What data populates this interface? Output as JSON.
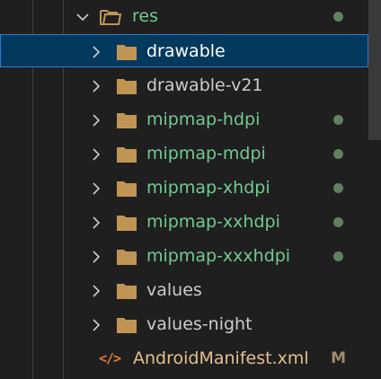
{
  "explorer": {
    "res_folder": {
      "label": "res",
      "expanded": true,
      "status": "modified"
    },
    "items": [
      {
        "label": "drawable",
        "selected": true,
        "status": "none"
      },
      {
        "label": "drawable-v21",
        "selected": false,
        "status": "none"
      },
      {
        "label": "mipmap-hdpi",
        "selected": false,
        "status": "untracked"
      },
      {
        "label": "mipmap-mdpi",
        "selected": false,
        "status": "untracked"
      },
      {
        "label": "mipmap-xhdpi",
        "selected": false,
        "status": "untracked"
      },
      {
        "label": "mipmap-xxhdpi",
        "selected": false,
        "status": "untracked"
      },
      {
        "label": "mipmap-xxxhdpi",
        "selected": false,
        "status": "untracked"
      },
      {
        "label": "values",
        "selected": false,
        "status": "none"
      },
      {
        "label": "values-night",
        "selected": false,
        "status": "none"
      }
    ],
    "manifest": {
      "icon": "xml-file-icon",
      "icon_text": "</>",
      "label": "AndroidManifest.xml",
      "badge": "M"
    }
  },
  "colors": {
    "background": "#1f1f1f",
    "selection_bg": "#04395e",
    "selection_border": "#2b79d9",
    "folder": "#c09553",
    "untracked_text": "#73c991",
    "status_dot": "#62805f",
    "modified_text": "#e2c08d",
    "xml_icon": "#e37933",
    "default_text": "#cccccc"
  }
}
